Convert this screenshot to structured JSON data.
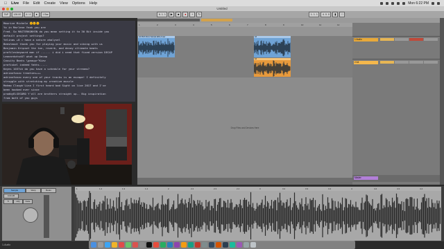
{
  "menubar": {
    "apple": "",
    "items": [
      "Live",
      "File",
      "Edit",
      "Create",
      "View",
      "Options",
      "Help"
    ],
    "clock": "Mon 6:22 PM"
  },
  "window": {
    "title": "Untitled"
  },
  "transport": {
    "tempo": "128.00",
    "signature": "4 / 4",
    "quantize": "1 Bar",
    "position": "6. 1. 1",
    "loop_start": "1. 1. 1",
    "loop_len": "4. 0. 0"
  },
  "chat": {
    "lines": [
      "Maurice Michele 🌞🌞🌞",
      "Yo in Marlene Yeah you are",
      "Fred. So MASTERKONYEN do you mean setting it to 30 Bit inside you",
      "default project settings?",
      "Yelinas +8 = have a nature ahalyvel",
      "Beeshnoot thank you for playing your music and vibing with us",
      "Benjamin Dripset the ton, reverb, and decay ultimate beats",
      "profileskeyword man if ...... i did i need that fixed version DECAP",
      "Leonardotvd4? what up Decap",
      "Cassity Beats \\geaupr^Kiev",
      "profiskel indeed Yahts.....",
      "Keyes 1037sh do you have a schedule for your streams?",
      "adrianfonzo treaties+++",
      "adrianfonzo every one of your tracks is an escape! I definitely",
      "struggle with stretching my creative muscle",
      "Mahmo Clough'Lina I first heard bad Sight on live 2017 and I've",
      "been hooked ever since",
      "prodbyELSEGORD Y'all are brothers straight up.. Big inspiration",
      "from both of you guys"
    ]
  },
  "arrangement": {
    "drop_text": "Drop Files and Devices Here",
    "clip_a_name": "A4 Pitch Drum Sample Edit+4.wav",
    "clip_b_name": "A4",
    "bars": [
      "1",
      "2",
      "3",
      "4",
      "5",
      "6",
      "7",
      "8",
      "9",
      "10",
      "11",
      "12"
    ]
  },
  "mixer": {
    "track1_name": "1 Audio",
    "track2_name": "2 A4",
    "master_name": "Master",
    "track1_color": "#e8a93a",
    "track2_color": "#f4b74c",
    "master_color": "#b27fd8"
  },
  "clipview": {
    "clip_name": "Sample",
    "gain_label": "0.00 dB",
    "warp_label": "Warp",
    "mode_label": "Beats",
    "sample_bars": [
      "1",
      "1.2",
      "1.3",
      "1.4",
      "2",
      "2.2",
      "2.3",
      "2.4",
      "3",
      "3.2",
      "3.3",
      "3.4",
      "4",
      "4.2",
      "4.3",
      "4.4"
    ]
  },
  "status": {
    "text": "1-Audio"
  },
  "colors": {
    "clip_blue": "#6fa3d6",
    "clip_orange": "#e89a3c",
    "wave_dark": "#1d2a36"
  }
}
